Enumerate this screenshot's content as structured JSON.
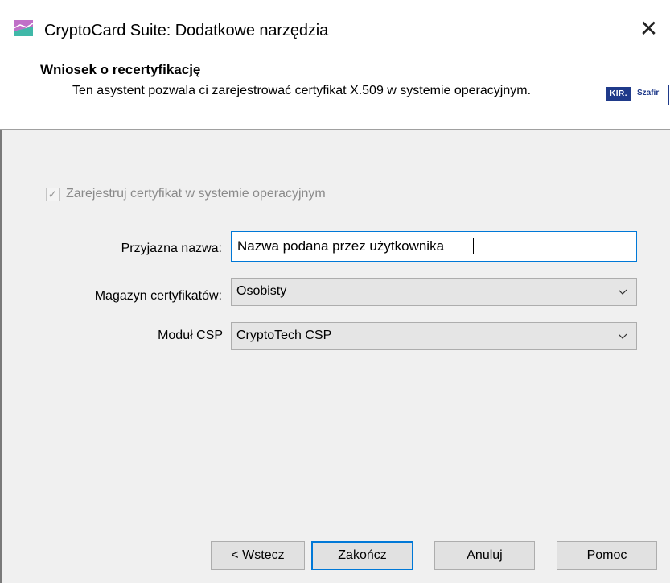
{
  "window": {
    "title": "CryptoCard Suite: Dodatkowe narzędzia",
    "close_glyph": "✕",
    "icon": "cryptocard-app-icon"
  },
  "header": {
    "title": "Wniosek o recertyfikację",
    "description": "Ten asystent pozwala ci zarejestrować certyfikat X.509 w systemie operacyjnym.",
    "logo_kir": "KIR.",
    "logo_szafir": "Szafir"
  },
  "form": {
    "register_checkbox": {
      "label": "Zarejestruj certyfikat w systemie operacyjnym",
      "checked": true,
      "disabled": true
    },
    "friendly_name": {
      "label": "Przyjazna nazwa:",
      "value": "Nazwa podana przez użytkownika"
    },
    "cert_store": {
      "label": "Magazyn certyfikatów:",
      "value": "Osobisty"
    },
    "csp_module": {
      "label": "Moduł CSP",
      "value": "CryptoTech CSP"
    }
  },
  "buttons": {
    "back": "< Wstecz",
    "finish": "Zakończ",
    "cancel": "Anuluj",
    "help": "Pomoc"
  },
  "colors": {
    "accent": "#0078d7",
    "window_bg": "#f0f0f0",
    "button_bg": "#e1e1e1",
    "logo_blue": "#1f3a8a"
  }
}
